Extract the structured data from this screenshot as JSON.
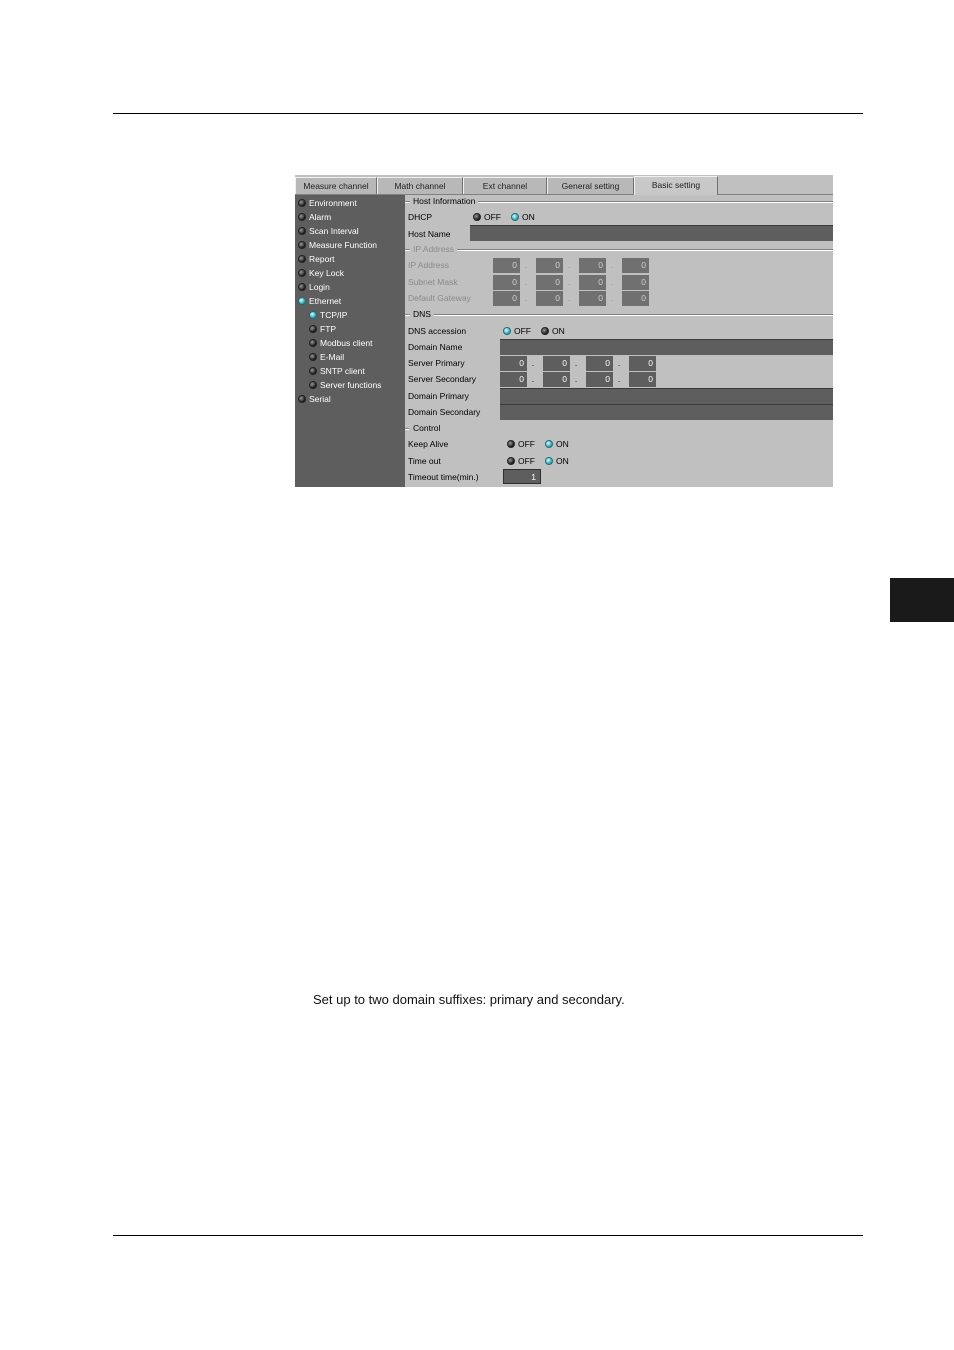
{
  "caption": "Set up to two domain suffixes: primary and secondary.",
  "screen": {
    "tabs": [
      "Measure channel",
      "Math channel",
      "Ext channel",
      "General setting",
      "Basic setting"
    ],
    "tree": [
      {
        "label": "Environment",
        "on": false
      },
      {
        "label": "Alarm",
        "on": false
      },
      {
        "label": "Scan Interval",
        "on": false
      },
      {
        "label": "Measure Function",
        "on": false
      },
      {
        "label": "Report",
        "on": false
      },
      {
        "label": "Key Lock",
        "on": false
      },
      {
        "label": "Login",
        "on": false
      },
      {
        "label": "Ethernet",
        "on": true
      },
      {
        "label": "TCP/IP",
        "on": true
      },
      {
        "label": "FTP",
        "on": false
      },
      {
        "label": "Modbus client",
        "on": false
      },
      {
        "label": "E-Mail",
        "on": false
      },
      {
        "label": "SNTP client",
        "on": false
      },
      {
        "label": "Server functions",
        "on": false
      },
      {
        "label": "Serial",
        "on": false
      }
    ],
    "host_info": {
      "title": "Host Information",
      "dhcp_label": "DHCP",
      "off": "OFF",
      "on": "ON",
      "dhcp_selected": "ON",
      "host_name_label": "Host Name",
      "host_name": ""
    },
    "ip": {
      "title": "IP Address",
      "ip_label": "IP Address",
      "ip": [
        "0",
        "0",
        "0",
        "0"
      ],
      "subnet_label": "Subnet Mask",
      "subnet": [
        "0",
        "0",
        "0",
        "0"
      ],
      "gateway_label": "Default Gateway",
      "gateway": [
        "0",
        "0",
        "0",
        "0"
      ]
    },
    "dns": {
      "title": "DNS",
      "accession_label": "DNS accession",
      "accession_selected": "OFF",
      "domain_name_label": "Domain Name",
      "server_primary_label": "Server Primary",
      "server_primary": [
        "0",
        "0",
        "0",
        "0"
      ],
      "server_secondary_label": "Server Secondary",
      "server_secondary": [
        "0",
        "0",
        "0",
        "0"
      ],
      "domain_primary_label": "Domain Primary",
      "domain_secondary_label": "Domain Secondary"
    },
    "control": {
      "title": "Control",
      "keep_alive_label": "Keep Alive",
      "keep_alive_selected": "ON",
      "timeout_label": "Time out",
      "timeout_selected": "ON",
      "timeout_time_label": "Timeout  time(min.)",
      "timeout_time": "1"
    }
  }
}
